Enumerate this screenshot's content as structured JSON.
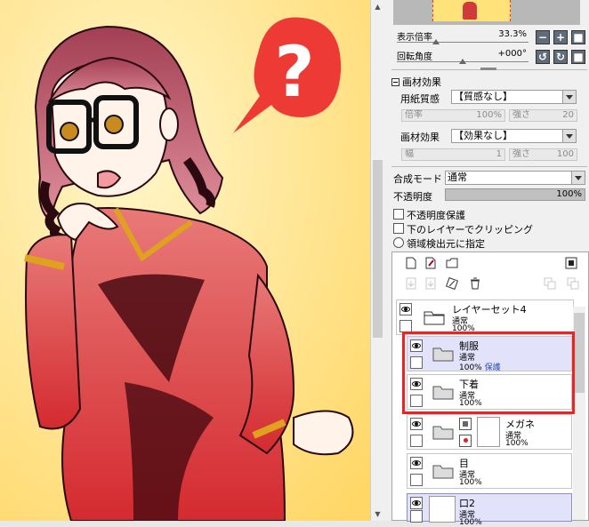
{
  "canvas": {
    "bubble_text": "?"
  },
  "navigator": {
    "zoom_label": "表示倍率",
    "zoom_value": "33.3%",
    "rotate_label": "回転角度",
    "rotate_value": "+000°",
    "buttons": {
      "zoom_out": "−",
      "zoom_in": "+",
      "reset": "■",
      "rot_left": "↺",
      "rot_right": "↻",
      "rot_reset": "■"
    }
  },
  "brush_effect": {
    "header": "画材効果",
    "paper_label": "用紙質感",
    "paper_value": "【質感なし】",
    "rate_label": "倍率",
    "rate_value": "100%",
    "strength_label": "強さ",
    "strength_value1": "20",
    "effect_label": "画材効果",
    "effect_value": "【効果なし】",
    "width_label": "幅",
    "width_value": "1",
    "strength_value2": "100"
  },
  "blend": {
    "mode_label": "合成モード",
    "mode_value": "通常",
    "opacity_label": "不透明度",
    "opacity_value": "100%"
  },
  "options": {
    "protect_opacity": "不透明度保護",
    "clip": "下のレイヤーでクリッピング",
    "detect_source": "領域検出元に指定"
  },
  "layers": [
    {
      "name": "レイヤーセット4",
      "mode": "通常",
      "opacity": "100%",
      "extra": ""
    },
    {
      "name": "制服",
      "mode": "通常",
      "opacity": "100%",
      "extra": "保護"
    },
    {
      "name": "下着",
      "mode": "通常",
      "opacity": "100%",
      "extra": ""
    },
    {
      "name": "メガネ",
      "mode": "通常",
      "opacity": "100%",
      "extra": ""
    },
    {
      "name": "目",
      "mode": "通常",
      "opacity": "100%",
      "extra": ""
    },
    {
      "name": "口2",
      "mode": "通常",
      "opacity": "100%",
      "extra": ""
    }
  ],
  "colors": {
    "accent_red": "#e22222",
    "selected_layer": "#e2e2fb",
    "canvas_bg": "#ffe27a"
  }
}
